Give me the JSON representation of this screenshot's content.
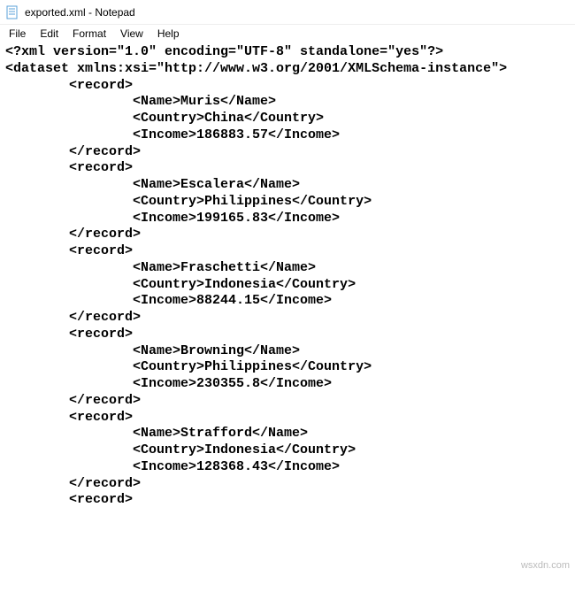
{
  "window": {
    "title": "exported.xml - Notepad"
  },
  "menu": {
    "file": "File",
    "edit": "Edit",
    "format": "Format",
    "view": "View",
    "help": "Help"
  },
  "xml": {
    "declaration": "<?xml version=\"1.0\" encoding=\"UTF-8\" standalone=\"yes\"?>",
    "root_open": "<dataset xmlns:xsi=\"http://www.w3.org/2001/XMLSchema-instance\">",
    "records": [
      {
        "name": "Muris",
        "country": "China",
        "income": "186883.57"
      },
      {
        "name": "Escalera",
        "country": "Philippines",
        "income": "199165.83"
      },
      {
        "name": "Fraschetti",
        "country": "Indonesia",
        "income": "88244.15"
      },
      {
        "name": "Browning",
        "country": "Philippines",
        "income": "230355.8"
      },
      {
        "name": "Strafford",
        "country": "Indonesia",
        "income": "128368.43"
      }
    ],
    "partial_last": "        <record>"
  },
  "watermark": "wsxdn.com"
}
